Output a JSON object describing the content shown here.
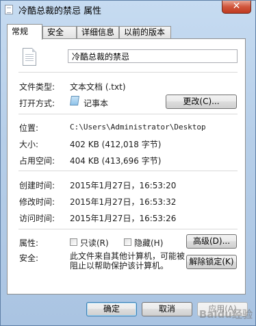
{
  "window": {
    "title": "冷酷总裁的禁忌 属性",
    "close_glyph": "✕"
  },
  "tabs": [
    {
      "label": "常规"
    },
    {
      "label": "安全"
    },
    {
      "label": "详细信息"
    },
    {
      "label": "以前的版本"
    }
  ],
  "general": {
    "filename": "冷酷总裁的禁忌",
    "type_label": "文件类型:",
    "type_value": "文本文档 (.txt)",
    "open_with_label": "打开方式:",
    "open_with_value": "记事本",
    "change_button": "更改(C)...",
    "location_label": "位置:",
    "location_value": "C:\\Users\\Administrator\\Desktop",
    "size_label": "大小:",
    "size_value": "402 KB (412,018 字节)",
    "size_on_disk_label": "占用空间:",
    "size_on_disk_value": "404 KB (413,696 字节)",
    "created_label": "创建时间:",
    "created_value": "2015年1月27日，16:53:20",
    "modified_label": "修改时间:",
    "modified_value": "2015年1月27日，16:53:32",
    "accessed_label": "访问时间:",
    "accessed_value": "2015年1月27日，16:53:26",
    "attributes_label": "属性:",
    "readonly_label": "只读(R)",
    "hidden_label": "隐藏(H)",
    "advanced_button": "高级(D)...",
    "security_label": "安全:",
    "security_text": "此文件来自其他计算机，可能被阻止以帮助保护该计算机。",
    "unblock_button": "解除锁定(K)"
  },
  "footer": {
    "ok_button": "确定",
    "cancel_button": "取消",
    "apply_button": "应用(A)"
  },
  "watermark": "Baidu经验"
}
